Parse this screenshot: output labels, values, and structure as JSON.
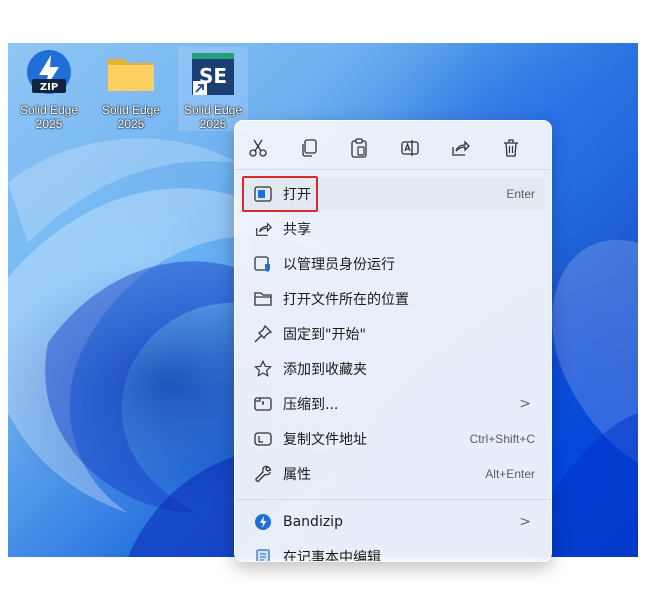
{
  "desktop": {
    "icons": [
      {
        "label_line1": "Solid Edge",
        "label_line2": "2025",
        "badge": "ZIP",
        "icon": "bandizip-zip-icon"
      },
      {
        "label_line1": "Solid Edge",
        "label_line2": "2025",
        "icon": "folder-icon"
      },
      {
        "label_line1": "Solid Edge",
        "label_line2": "2025",
        "badge": "SE",
        "icon": "solid-edge-shortcut-icon"
      }
    ]
  },
  "context_menu": {
    "toolbar": [
      {
        "name": "cut",
        "icon": "scissors-icon"
      },
      {
        "name": "copy",
        "icon": "copy-icon"
      },
      {
        "name": "paste",
        "icon": "clipboard-icon"
      },
      {
        "name": "rename",
        "icon": "rename-icon"
      },
      {
        "name": "share",
        "icon": "share-icon"
      },
      {
        "name": "delete",
        "icon": "trash-icon"
      }
    ],
    "items": [
      {
        "label": "打开",
        "shortcut": "Enter",
        "icon": "open-window-icon"
      },
      {
        "label": "共享",
        "icon": "share-icon"
      },
      {
        "label": "以管理员身份运行",
        "icon": "shield-icon"
      },
      {
        "label": "打开文件所在的位置",
        "icon": "folder-icon"
      },
      {
        "label": "固定到\"开始\"",
        "icon": "pin-icon"
      },
      {
        "label": "添加到收藏夹",
        "icon": "star-icon"
      },
      {
        "label": "压缩到...",
        "arrow": ">",
        "icon": "archive-icon"
      },
      {
        "label": "复制文件地址",
        "shortcut": "Ctrl+Shift+C",
        "icon": "copy-path-icon"
      },
      {
        "label": "属性",
        "shortcut": "Alt+Enter",
        "icon": "wrench-icon"
      },
      {
        "label": "Bandizip",
        "arrow": ">",
        "icon": "bandizip-icon"
      },
      {
        "label": "在记事本中编辑",
        "icon": "notepad-icon"
      }
    ]
  },
  "colors": {
    "highlight_box": "#d62b2b",
    "menu_bg": "#f0f4fb",
    "bandizip_blue": "#1f6fd6"
  }
}
